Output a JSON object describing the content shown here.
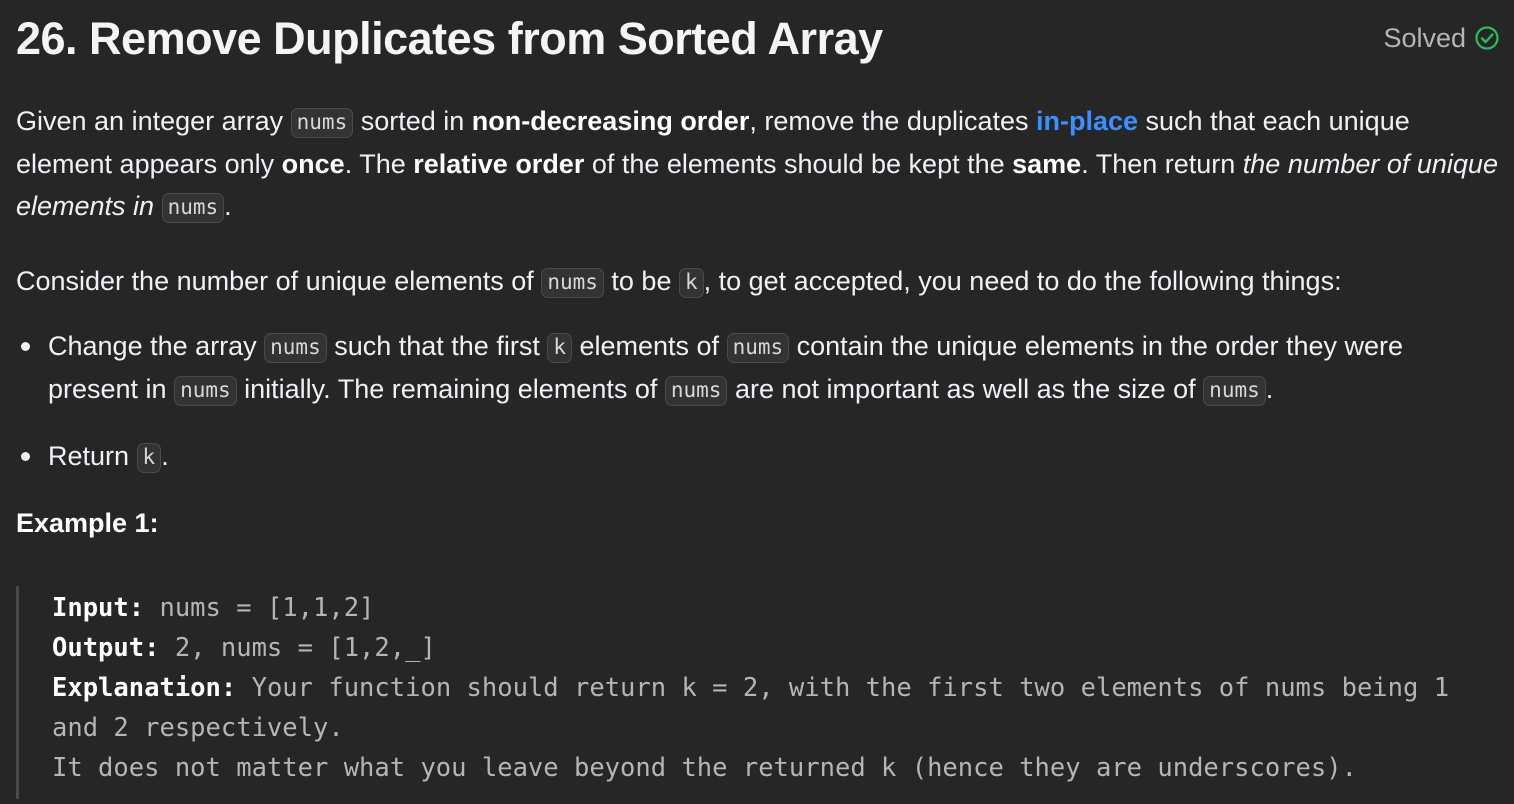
{
  "problem": {
    "title": "26. Remove Duplicates from Sorted Array",
    "status": "Solved",
    "status_color": "#2cbb5d",
    "status_icon": "check-circle-icon"
  },
  "description": {
    "p1": {
      "t1": "Given an integer array ",
      "c1": "nums",
      "t2": " sorted in ",
      "b1": "non-decreasing order",
      "t3": ", remove the duplicates ",
      "link": "in-place",
      "t4": " such that each unique element appears only ",
      "b2": "once",
      "t5": ". The ",
      "b3": "relative order",
      "t6": " of the elements should be kept the ",
      "b4": "same",
      "t7": ". Then return ",
      "i1": "the number of unique elements in ",
      "c2": "nums",
      "t8": "."
    },
    "p2": {
      "t1": "Consider the number of unique elements of ",
      "c1": "nums",
      "t2": " to be ",
      "c2": "k",
      "t3": ", to get accepted, you need to do the following things:"
    },
    "bullets": [
      {
        "t1": "Change the array ",
        "c1": "nums",
        "t2": " such that the first ",
        "c2": "k",
        "t3": " elements of ",
        "c3": "nums",
        "t4": " contain the unique elements in the order they were present in ",
        "c4": "nums",
        "t5": " initially. The remaining elements of ",
        "c5": "nums",
        "t6": " are not important as well as the size of ",
        "c6": "nums",
        "t7": "."
      },
      {
        "t1": "Return ",
        "c1": "k",
        "t2": "."
      }
    ]
  },
  "example": {
    "title": "Example 1:",
    "input_label": "Input:",
    "input_value": " nums = [1,1,2]",
    "output_label": "Output:",
    "output_value": " 2, nums = [1,2,_]",
    "explanation_label": "Explanation:",
    "explanation_value": " Your function should return k = 2, with the first two elements of nums being 1 and 2 respectively.",
    "explanation_value2": "It does not matter what you leave beyond the returned k (hence they are underscores)."
  }
}
